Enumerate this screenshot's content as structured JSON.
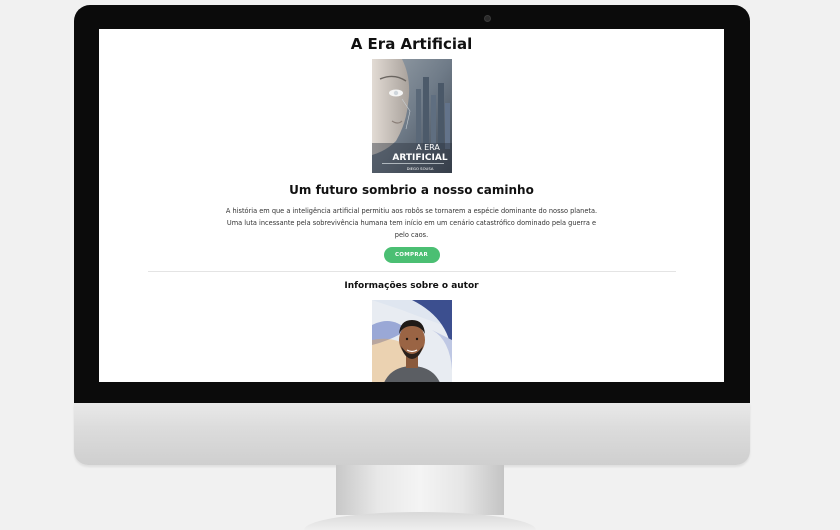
{
  "page": {
    "title": "A Era Artificial",
    "cover": {
      "title_line1": "A ERA",
      "title_line2": "ARTIFICIAL",
      "author": "DIEGO SOUSA"
    },
    "subtitle": "Um futuro sombrio a nosso caminho",
    "description": "A história em que a inteligência artificial permitiu aos robôs se tornarem a espécie dominante do nosso planeta. Uma luta incessante pela sobrevivência humana tem início em um cenário catastrófico dominado pela guerra e pelo caos.",
    "buy_label": "COMPRAR",
    "author_heading": "Informações sobre o autor"
  },
  "colors": {
    "accent": "#4bbf73",
    "screen_bg": "#ffffff",
    "bezel": "#0b0b0b"
  }
}
